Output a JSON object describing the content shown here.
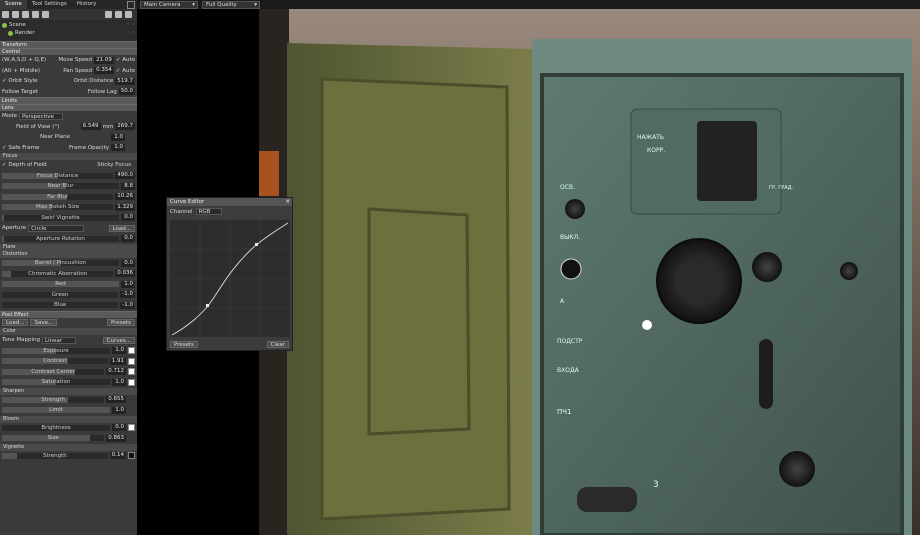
{
  "tabs": [
    "Scene",
    "Tool Settings",
    "History"
  ],
  "tree": {
    "root": "Scene",
    "child": "Render"
  },
  "sections": {
    "transform": "Transform",
    "control": "Control",
    "limits": "Limits",
    "lens": "Lens",
    "focus": "Focus",
    "flare": "Flare",
    "distortion": "Distortion",
    "post_effect": "Post Effect",
    "color": "Color",
    "sharpen": "Sharpen",
    "bloom": "Bloom",
    "vignette": "Vignette"
  },
  "control": {
    "keys_label": "(W,A,S,D + Q,E)",
    "move_speed_label": "Move Speed",
    "move_speed": "21.09",
    "auto1": "✓ Auto",
    "alt_label": "(Alt + Middle)",
    "pan_speed_label": "Pan Speed",
    "pan_speed": "0.354",
    "auto2": "✓ Auto",
    "orbit_style": "✓ Orbit Style",
    "orbit_distance_label": "Orbit Distance",
    "orbit_distance": "519.7",
    "follow_target": "Follow Target",
    "follow_lag_label": "Follow Lag",
    "follow_lag": "50.0"
  },
  "lens": {
    "mode_label": "Mode",
    "mode": "Perspective",
    "fov_label": "Field of View (°)",
    "fov": "6.549",
    "mm_label": "mm",
    "mm": "269.7",
    "near_label": "Near Plane",
    "near": "1.0",
    "safe_frame": "✓ Safe Frame",
    "frame_opacity_label": "Frame Opacity",
    "frame_opacity": "1.0"
  },
  "focus": {
    "dof": "✓ Depth of Field",
    "sticky": "Sticky Focus",
    "focus_distance_label": "Focus Distance",
    "focus_distance": "490.0",
    "near_blur_label": "Near Blur",
    "near_blur": "8.8",
    "far_blur_label": "Far Blur",
    "far_blur": "10.26",
    "bokeh_label": "Max Bokeh Size",
    "bokeh": "1.329",
    "swirl_label": "Swirl Vignette",
    "swirl": "0.0",
    "aperture_label": "Aperture",
    "aperture": "Circle",
    "load": "Load...",
    "rotation_label": "Aperture Rotation",
    "rotation": "0.0"
  },
  "distortion": {
    "barrel_label": "Barrel / Pincushion",
    "barrel": "0.0",
    "ca_label": "Chromatic Aberration",
    "ca": "0.036",
    "red_label": "Red",
    "red": "1.0",
    "green_label": "Green",
    "green": "-1.0",
    "blue_label": "Blue",
    "blue": "-1.0"
  },
  "post": {
    "load": "Load...",
    "save": "Save...",
    "presets": "Presets",
    "tone_label": "Tone Mapping",
    "tone": "Linear",
    "curves": "Curves...",
    "exposure_label": "Exposure",
    "exposure": "1.0",
    "contrast_label": "Contrast",
    "contrast": "1.91",
    "contrast_center_label": "Contrast Center",
    "contrast_center": "0.712",
    "saturation_label": "Saturation",
    "saturation": "1.0",
    "strength_label": "Strength",
    "strength": "0.655",
    "limit_label": "Limit",
    "limit": "1.0",
    "brightness_label": "Brightness",
    "brightness": "0.0",
    "size_label": "Size",
    "size": "0.863",
    "vig_strength_label": "Strength",
    "vig_strength": "0.14"
  },
  "viewport": {
    "camera": "Main Camera",
    "quality": "Full Quality"
  },
  "curve_editor": {
    "title": "Curve Editor",
    "close": "✕",
    "channel_label": "Channel",
    "channel": "RGB",
    "presets": "Presets",
    "clear": "Clear"
  },
  "device": {
    "plate1": "НАЖАТЬ",
    "plate2": "КОРР.",
    "osv": "ОСВ.",
    "vykl": "ВЫКЛ.",
    "podstr": "ПОДСТР",
    "vkhoda": "ВХОДА",
    "pch1": "ПЧ1",
    "a": "A",
    "three": "3",
    "grad": "ГР. ГРАД."
  }
}
